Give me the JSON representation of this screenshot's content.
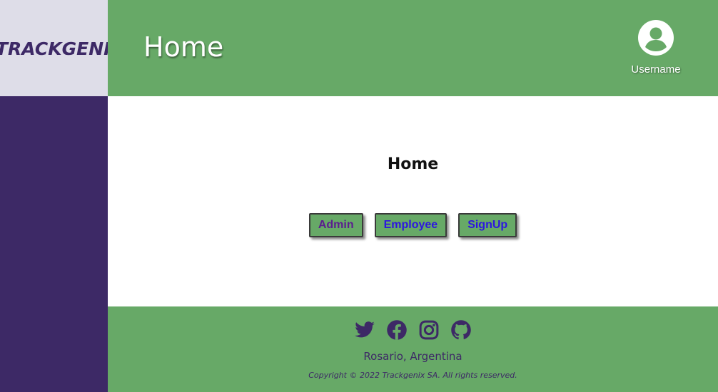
{
  "brand": {
    "logo_text": "TRACKGENIX"
  },
  "header": {
    "title": "Home",
    "user": {
      "name": "Username",
      "avatar_icon": "user-circle-icon"
    }
  },
  "main": {
    "title": "Home",
    "buttons": [
      {
        "label": "Admin"
      },
      {
        "label": "Employee"
      },
      {
        "label": "SignUp"
      }
    ]
  },
  "footer": {
    "social_icons": [
      "twitter-icon",
      "facebook-icon",
      "instagram-icon",
      "github-icon"
    ],
    "location": "Rosario, Argentina",
    "copyright": "Copyright © 2022 Trackgenix SA. All rights reserved."
  },
  "colors": {
    "primary_green": "#67a967",
    "brand_purple": "#3d2966",
    "logo_bg": "#dedde8",
    "admin_text": "#5b1e8e",
    "link_blue": "#2d16e0"
  }
}
